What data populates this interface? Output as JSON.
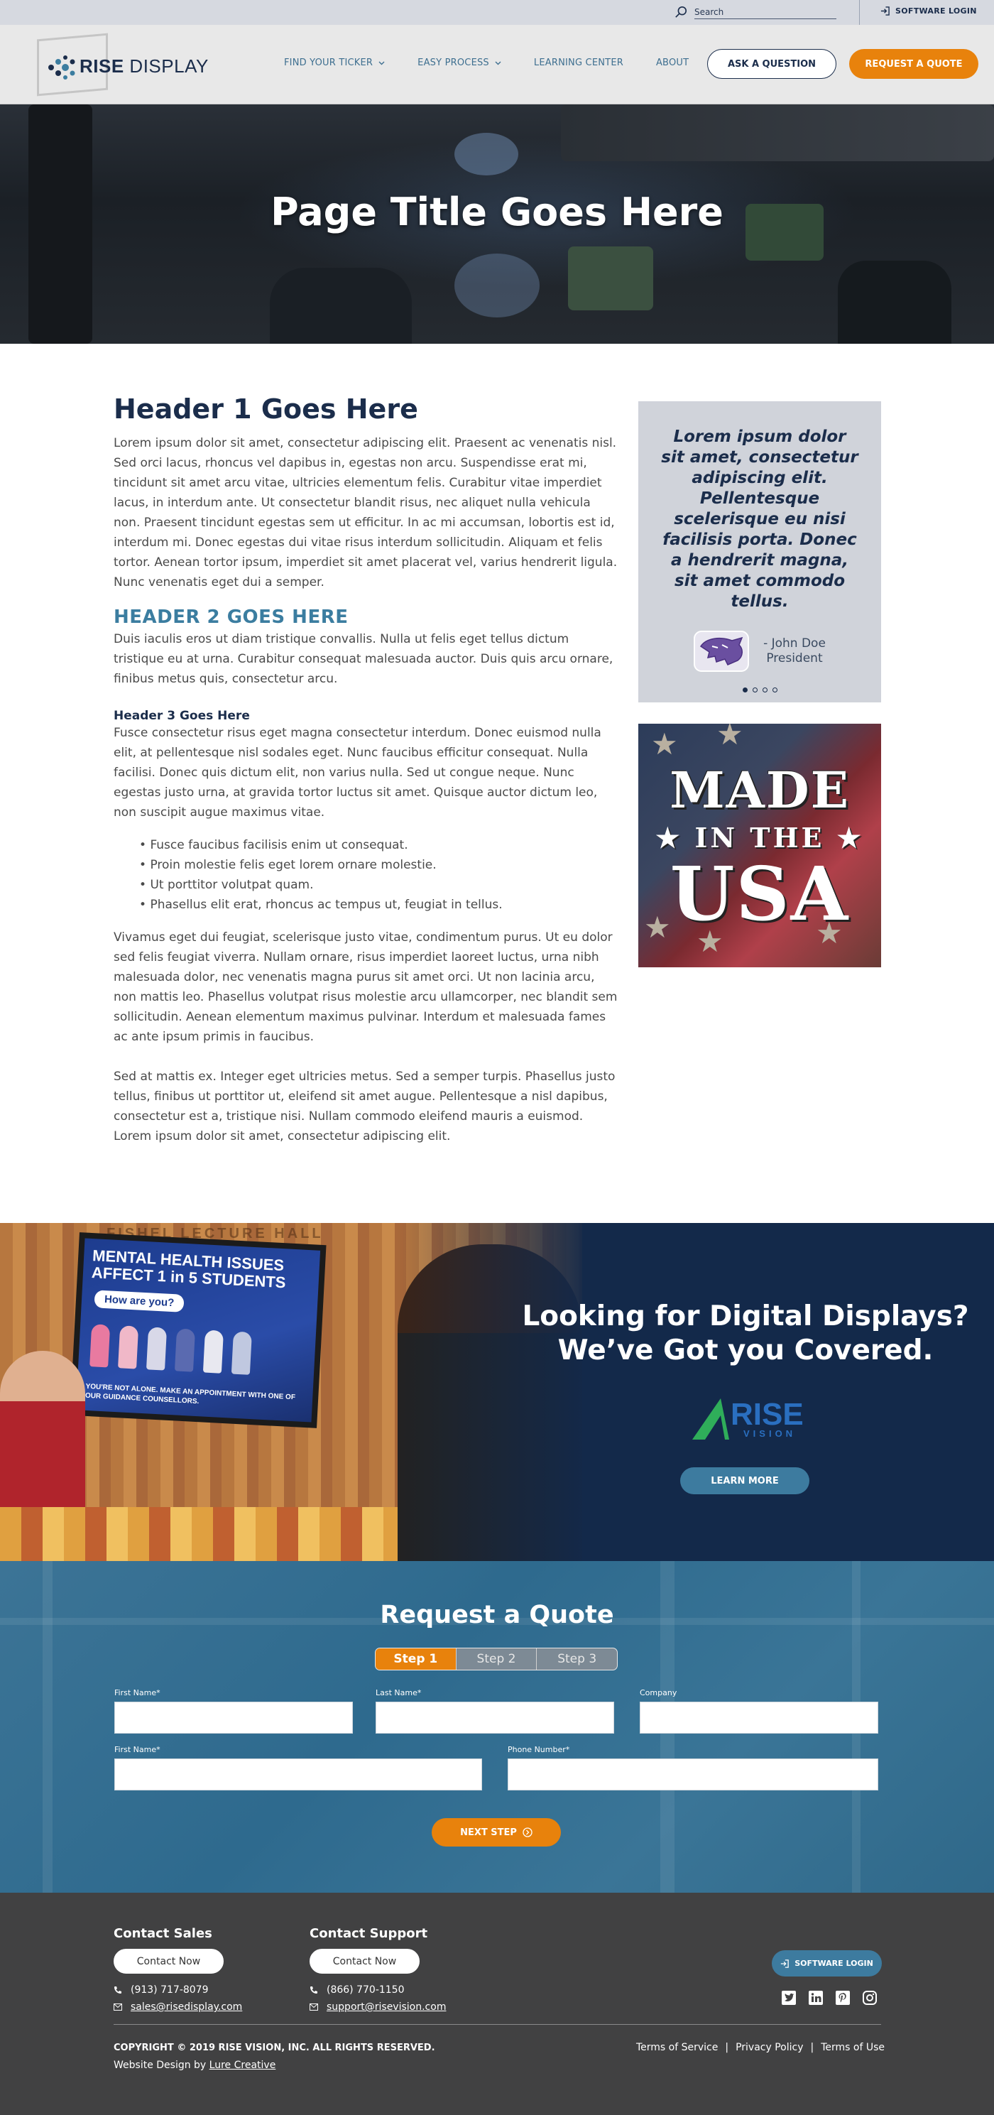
{
  "utility": {
    "search_placeholder": "Search",
    "login_label": "SOFTWARE LOGIN"
  },
  "header": {
    "logo_rise": "RISE",
    "logo_display": "DISPLAY",
    "nav": [
      {
        "label": "FIND YOUR TICKER",
        "has_dropdown": true
      },
      {
        "label": "EASY PROCESS",
        "has_dropdown": true
      },
      {
        "label": "LEARNING CENTER",
        "has_dropdown": false
      },
      {
        "label": "ABOUT",
        "has_dropdown": false
      }
    ],
    "ask_label": "ASK A QUESTION",
    "quote_label": "REQUEST A QUOTE"
  },
  "hero": {
    "title": "Page Title Goes Here"
  },
  "content": {
    "h1": "Header 1 Goes Here",
    "p1": "Lorem ipsum dolor sit amet, consectetur adipiscing elit. Praesent ac venenatis nisl. Sed orci lacus, rhoncus vel dapibus in, egestas non arcu. Suspendisse erat mi, tincidunt sit amet arcu vitae, ultricies elementum felis. Curabitur vitae imperdiet lacus, in interdum ante. Ut consectetur blandit risus, nec aliquet nulla vehicula non. Praesent tincidunt egestas sem ut efficitur. In ac mi accumsan, lobortis est id, interdum mi. Donec egestas dui vitae risus interdum sollicitudin. Aliquam et felis tortor. Aenean tortor ipsum, imperdiet sit amet placerat vel, varius hendrerit ligula. Nunc venenatis eget dui a semper.",
    "h2": "HEADER 2 GOES HERE",
    "p2": "Duis iaculis eros ut diam tristique convallis. Nulla ut felis eget tellus dictum tristique eu at urna. Curabitur consequat malesuada auctor. Duis quis arcu ornare, finibus metus quis, consectetur arcu.",
    "h3": "Header 3 Goes Here",
    "p3": "Fusce consectetur risus eget magna consectetur interdum. Donec euismod nulla elit, at pellentesque nisl sodales eget. Nunc faucibus efficitur consequat. Nulla facilisi. Donec quis dictum elit, non varius nulla. Sed ut congue neque. Nunc egestas justo urna, at gravida tortor luctus sit amet. Quisque auctor dictum leo, non suscipit augue maximus vitae.",
    "bullets": [
      "Fusce faucibus facilisis enim ut consequat.",
      "Proin molestie felis eget lorem ornare molestie.",
      "Ut porttitor volutpat quam.",
      "Phasellus elit erat, rhoncus ac tempus ut, feugiat in tellus."
    ],
    "p4": "Vivamus eget dui feugiat, scelerisque justo vitae, condimentum purus. Ut eu dolor sed felis feugiat viverra. Nullam ornare, risus imperdiet laoreet luctus, urna nibh malesuada dolor, nec venenatis magna purus sit amet orci. Ut non lacinia arcu, non mattis leo. Phasellus volutpat risus molestie arcu ullamcorper, nec blandit sem sollicitudin. Aenean elementum maximus pulvinar. Interdum et malesuada fames ac ante ipsum primis in faucibus.",
    "p5": "Sed at mattis ex. Integer eget ultricies metus. Sed a semper turpis. Phasellus justo tellus, finibus ut porttitor ut, eleifend sit amet augue. Pellentesque a nisl dapibus, consectetur est a, tristique nisi. Nullam commodo eleifend mauris a euismod. Lorem ipsum dolor sit amet, consectetur adipiscing elit."
  },
  "testimonial": {
    "quote": "Lorem ipsum dolor sit amet, consectetur adipiscing elit. Pellentesque scelerisque eu nisi facilisis porta. Donec a hendrerit magna, sit amet commodo tellus.",
    "name": "- John Doe",
    "role": "President",
    "slides": 4,
    "active_slide": 1
  },
  "usa": {
    "made": "MADE",
    "in_the": "IN THE",
    "usa": "USA"
  },
  "banner": {
    "tv_heading": "MENTAL HEALTH ISSUES AFFECT 1 in 5 STUDENTS",
    "tv_bubble": "How are you?",
    "tv_footer": "YOU'RE NOT ALONE. MAKE AN APPOINTMENT WITH ONE OF OUR GUIDANCE COUNSELLORS.",
    "wall_text": "FISHEL LECTURE HALL",
    "title_line1": "Looking for Digital Displays?",
    "title_line2": "We’ve Got you Covered.",
    "logo_word": "RISE",
    "logo_sub": "VISION",
    "learn_label": "LEARN MORE"
  },
  "quote_form": {
    "title": "Request a Quote",
    "steps": [
      "Step 1",
      "Step 2",
      "Step 3"
    ],
    "active_step": 1,
    "fields": {
      "first_name": "First Name",
      "last_name": "Last Name",
      "company": "Company",
      "first_name_2": "First Name",
      "phone": "Phone Number"
    },
    "required_marker": "*",
    "next_label": "NEXT STEP"
  },
  "footer": {
    "sales_heading": "Contact Sales",
    "sales_button": "Contact Now",
    "sales_phone": "(913) 717-8079",
    "sales_email": "sales@risedisplay.com",
    "support_heading": "Contact Support",
    "support_button": "Contact Now",
    "support_phone": "(866) 770-1150",
    "support_email": "support@risevision.com",
    "login_label": "SOFTWARE LOGIN",
    "socials": [
      "twitter-icon",
      "linkedin-icon",
      "pinterest-icon",
      "instagram-icon"
    ],
    "copyright": "COPYRIGHT © 2019 RISE VISION, INC. ALL RIGHTS RESERVED.",
    "design_prefix": "Website Design by",
    "design_link": "Lure Creative",
    "legal": [
      "Terms of Service",
      "Privacy Policy",
      "Terms of Use"
    ],
    "legal_sep": "|"
  },
  "colors": {
    "navy": "#1b2d4b",
    "teal": "#3b7da0",
    "orange": "#e8820c",
    "footer_bg": "#414142"
  }
}
